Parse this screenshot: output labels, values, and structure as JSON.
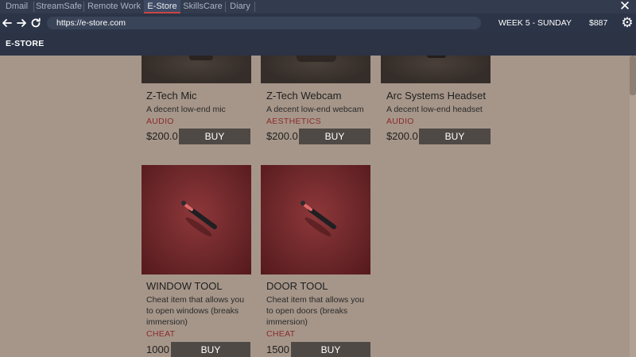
{
  "tabs": [
    {
      "label": "Dmail",
      "active": false
    },
    {
      "label": "StreamSafe",
      "active": false
    },
    {
      "label": "Remote Work",
      "active": false
    },
    {
      "label": "E-Store",
      "active": true
    },
    {
      "label": "SkillsCare",
      "active": false
    },
    {
      "label": "Diary",
      "active": false
    }
  ],
  "toolbar": {
    "close_icon": "close-icon",
    "back_icon": "arrow-left-icon",
    "forward_icon": "arrow-right-icon",
    "reload_icon": "reload-icon",
    "settings_icon": "gear-icon",
    "url": "https://e-store.com",
    "week": "WEEK 5 - SUNDAY",
    "money": "$887"
  },
  "store": {
    "header": "E-STORE"
  },
  "products": [
    {
      "name": "Z-Tech Mic",
      "description": "A decent low-end mic",
      "category": "AUDIO",
      "price": "$200.0",
      "buy_label": "BUY"
    },
    {
      "name": "Z-Tech Webcam",
      "description": "A decent low-end webcam",
      "category": "AESTHETICS",
      "price": "$200.0",
      "buy_label": "BUY"
    },
    {
      "name": "Arc Systems Headset",
      "description": "A decent low-end headset",
      "category": "AUDIO",
      "price": "$200.0",
      "buy_label": "BUY"
    },
    {
      "name": "WINDOW TOOL",
      "description": "Cheat item that allows you to open windows (breaks immersion)",
      "category": "CHEAT",
      "price": "1000",
      "buy_label": "BUY"
    },
    {
      "name": "DOOR TOOL",
      "description": "Cheat item that allows you to open doors (breaks immersion)",
      "category": "CHEAT",
      "price": "1500",
      "buy_label": "BUY"
    }
  ],
  "colors": {
    "tabbar": "#333c4e",
    "active_tab_underline": "#c94444",
    "page_bg": "#a69689",
    "category": "#8b2a2a",
    "buy_button": "#4f4945"
  }
}
